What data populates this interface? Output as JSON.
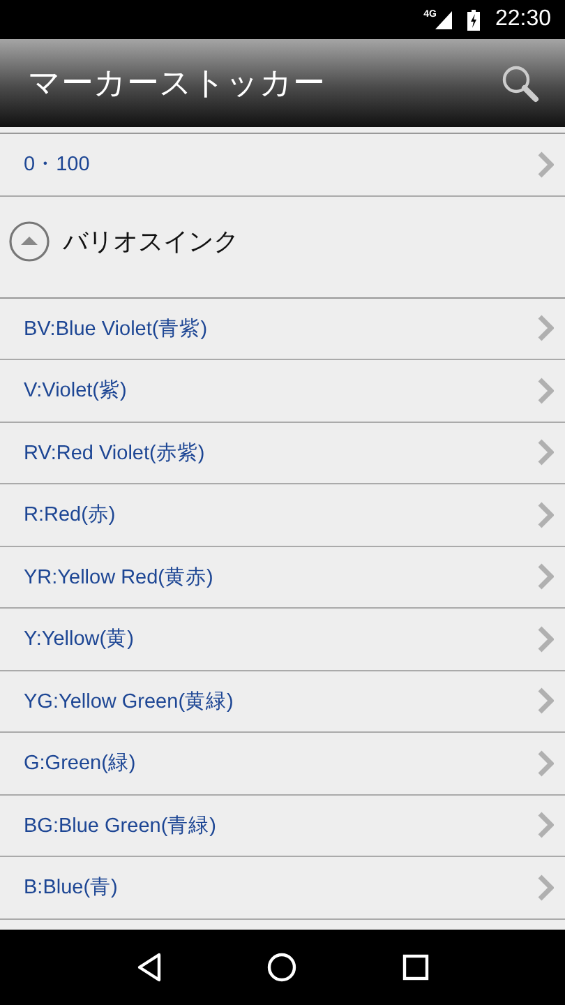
{
  "status_bar": {
    "network": "4G",
    "time": "22:30"
  },
  "app_bar": {
    "title": "マーカーストッカー"
  },
  "top_item": {
    "label": "0・100"
  },
  "group": {
    "title": "バリオスインク",
    "expanded": true,
    "items": [
      {
        "label": "BV:Blue Violet(青紫)"
      },
      {
        "label": "V:Violet(紫)"
      },
      {
        "label": "RV:Red Violet(赤紫)"
      },
      {
        "label": "R:Red(赤)"
      },
      {
        "label": "YR:Yellow Red(黄赤)"
      },
      {
        "label": "Y:Yellow(黄)"
      },
      {
        "label": "YG:Yellow Green(黄緑)"
      },
      {
        "label": "G:Green(緑)"
      },
      {
        "label": "BG:Blue Green(青緑)"
      },
      {
        "label": "B:Blue(青)"
      }
    ]
  }
}
